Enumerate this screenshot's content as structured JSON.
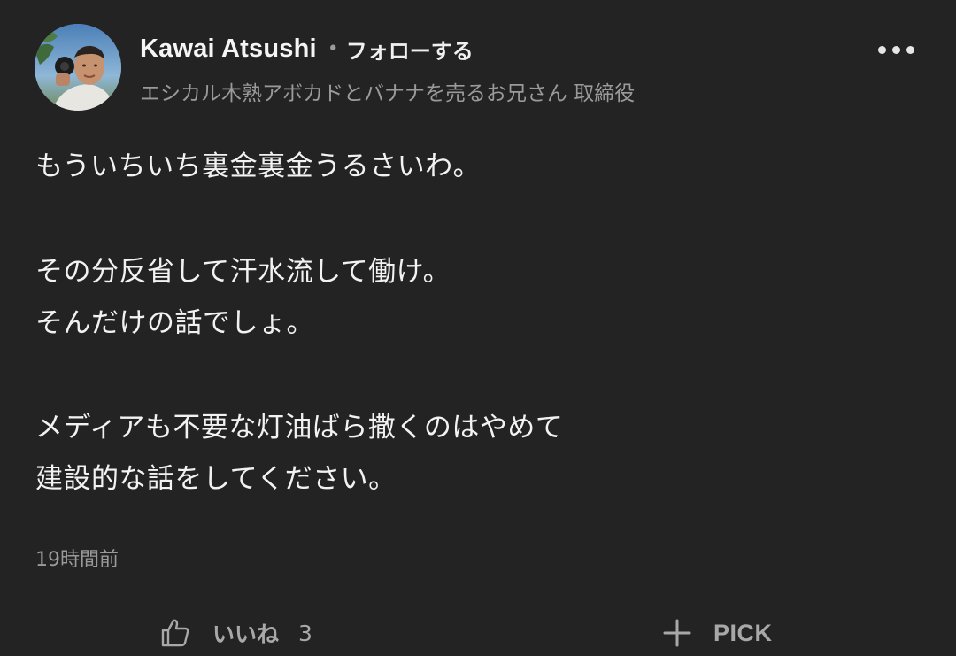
{
  "comment": {
    "author": {
      "name": "Kawai Atsushi",
      "follow_label": "フォローする",
      "title": "エシカル木熟アボカドとバナナを売るお兄さん 取締役",
      "avatar_icon": "profile-photo"
    },
    "body_lines": [
      "もういちいち裏金裏金うるさいわ。",
      "その分反省して汗水流して働け。",
      "そんだけの話でしょ。",
      "メディアも不要な灯油ばら撒くのはやめて",
      "建設的な話をしてください。"
    ],
    "timestamp": "19時間前"
  },
  "actions": {
    "like_label": "いいね",
    "like_count": "3",
    "like_icon": "thumbs-up-icon",
    "pick_label": "PICK",
    "pick_icon": "plus-icon",
    "more_icon": "more-dots-icon"
  },
  "colors": {
    "background": "#232323",
    "text_primary": "#f2f2f2",
    "text_secondary": "#9a9a9a"
  }
}
